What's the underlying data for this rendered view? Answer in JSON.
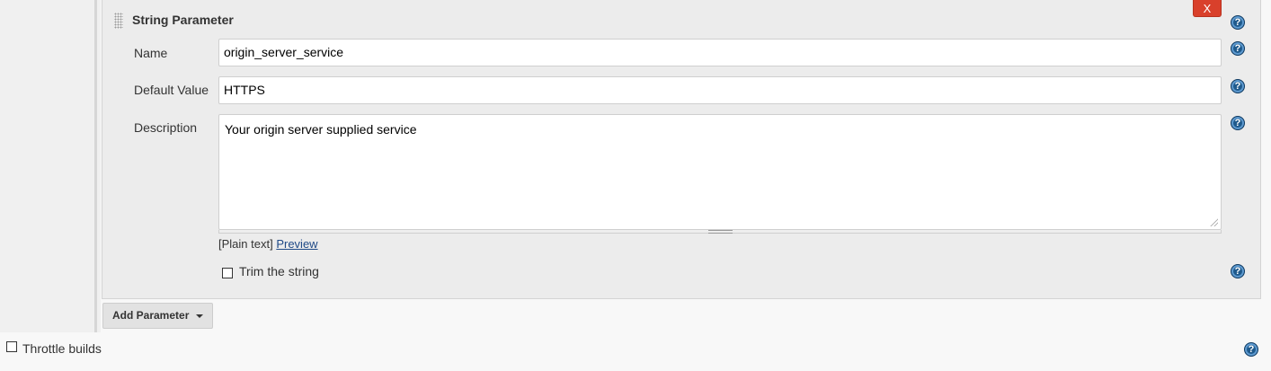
{
  "parameter": {
    "title": "String Parameter",
    "delete_label": "X",
    "name": {
      "label": "Name",
      "value": "origin_server_service"
    },
    "default_value": {
      "label": "Default Value",
      "value": "HTTPS"
    },
    "description": {
      "label": "Description",
      "value": "Your origin server supplied service",
      "format_text": "[Plain text]",
      "preview_label": "Preview"
    },
    "trim": {
      "label": "Trim the string",
      "checked": false
    }
  },
  "add_parameter": {
    "label": "Add Parameter"
  },
  "throttle": {
    "label": "Throttle builds",
    "checked": false
  },
  "help_glyph": "?",
  "icons": [
    "drag-handle-icon",
    "help-icon",
    "caret-down-icon",
    "resize-grip-icon"
  ],
  "colors": {
    "delete": "#d9402b",
    "help": "#1f5a8c",
    "link": "#204a87"
  }
}
